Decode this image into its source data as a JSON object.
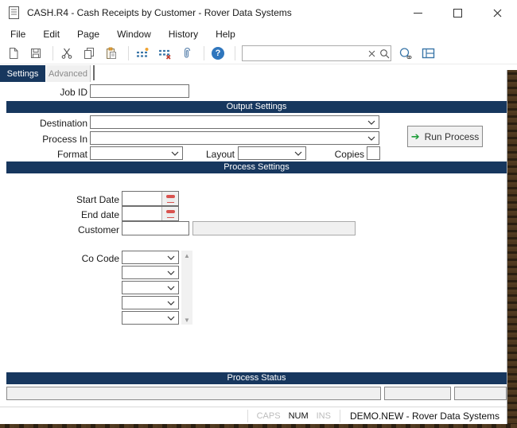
{
  "window": {
    "title": "CASH.R4 - Cash Receipts by Customer - Rover Data Systems"
  },
  "menu": {
    "items": [
      "File",
      "Edit",
      "Page",
      "Window",
      "History",
      "Help"
    ]
  },
  "toolbar": {
    "search_value": "",
    "icons": [
      "new-document",
      "save",
      "cut",
      "copy",
      "paste",
      "insert-rows",
      "delete-rows",
      "attach",
      "help",
      "search-clear",
      "search",
      "preview",
      "layout"
    ]
  },
  "tabs": [
    {
      "label": "Settings",
      "active": true
    },
    {
      "label": "Advanced",
      "active": false
    }
  ],
  "form": {
    "job_id_label": "Job ID",
    "job_id_value": "",
    "output": {
      "title": "Output Settings",
      "destination_label": "Destination",
      "destination_value": "",
      "process_in_label": "Process In",
      "process_in_value": "",
      "format_label": "Format",
      "format_value": "",
      "layout_label": "Layout",
      "layout_value": "",
      "copies_label": "Copies",
      "copies_value": "",
      "run_button_label": "Run Process"
    },
    "process": {
      "title": "Process Settings",
      "start_date_label": "Start Date",
      "start_date_value": "",
      "end_date_label": "End date",
      "end_date_value": "",
      "customer_label": "Customer",
      "customer_value": "",
      "customer_name_value": "",
      "co_code_label": "Co Code",
      "co_code_values": [
        "",
        "",
        "",
        "",
        ""
      ]
    },
    "status_section": {
      "title": "Process Status",
      "status_value": "",
      "field2_value": "",
      "field3_value": ""
    }
  },
  "status_bar": {
    "caps": "CAPS",
    "num": "NUM",
    "ins": "INS",
    "message": "DEMO.NEW - Rover Data Systems"
  },
  "icons": {
    "help_glyph": "?"
  },
  "colors": {
    "section_header": "#17375e",
    "active_tab": "#17375e",
    "run_arrow_green": "#1f9d3a",
    "calendar_red": "#d9534f",
    "help_blue": "#2f76bd",
    "toolbar_icon_blue": "#3a76a8",
    "disabled_text": "#bcbcbc",
    "desktop_brown": "#3c2c1a"
  }
}
